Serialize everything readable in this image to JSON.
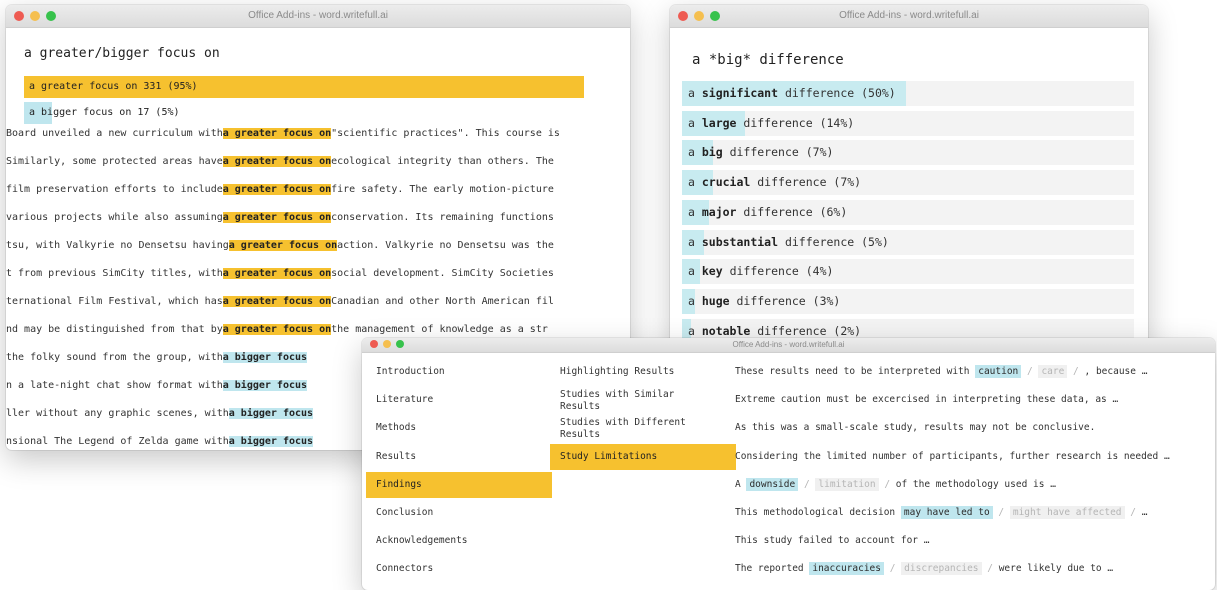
{
  "windows": {
    "w1": {
      "title": "Office Add-ins - word.writefull.ai",
      "query": "a greater/bigger focus on",
      "suggestions": [
        {
          "text": "a greater focus on 331 (95%)",
          "style": "yellow"
        },
        {
          "text": "a bigger focus on 17 (5%)",
          "style": "blue"
        }
      ],
      "examples": [
        {
          "pre": "Board unveiled a new curriculum with",
          "hl": "a greater focus on",
          "post": "\"scientific practices\". This course is",
          "color": "yellow"
        },
        {
          "pre": " Similarly, some protected areas have",
          "hl": "a greater focus on",
          "post": "ecological integrity than others. The",
          "color": "yellow"
        },
        {
          "pre": "  film preservation efforts to include",
          "hl": "a greater focus on",
          "post": "fire safety. The early motion-picture",
          "color": "yellow"
        },
        {
          "pre": " various projects while also assuming",
          "hl": "a greater focus on",
          "post": "conservation. Its remaining functions",
          "color": "yellow"
        },
        {
          "pre": " tsu, with Valkyrie no Densetsu having",
          "hl": "a greater focus on",
          "post": "action. Valkyrie no Densetsu was the",
          "color": "yellow"
        },
        {
          "pre": " t from previous SimCity titles, with",
          "hl": "a greater focus on",
          "post": "social development. SimCity Societies",
          "color": "yellow"
        },
        {
          "pre": "ternational Film Festival, which has",
          "hl": "a greater focus on",
          "post": "Canadian and other North American fil",
          "color": "yellow"
        },
        {
          "pre": "nd may be distinguished from that by",
          "hl": "a greater focus on",
          "post": "the management of knowledge as a str",
          "color": "yellow"
        },
        {
          "pre": "  the folky sound from the group, with",
          "hl": "a bigger focus",
          "post": "",
          "color": "blue"
        },
        {
          "pre": " n a late-night chat show format with",
          "hl": "a bigger focus",
          "post": "",
          "color": "blue"
        },
        {
          "pre": " ller without any graphic scenes, with",
          "hl": "a bigger focus",
          "post": "",
          "color": "blue"
        },
        {
          "pre": " nsional The Legend of Zelda game with",
          "hl": "a bigger focus",
          "post": "",
          "color": "blue"
        }
      ]
    },
    "w2": {
      "title": "Office Add-ins - word.writefull.ai",
      "query": "a *big* difference",
      "rows": [
        {
          "pre": "a ",
          "word": "significant",
          "post": " difference (50%)",
          "pct": 50
        },
        {
          "pre": "a ",
          "word": "large",
          "post": " difference (14%)",
          "pct": 14
        },
        {
          "pre": "a ",
          "word": "big",
          "post": " difference (7%)",
          "pct": 7
        },
        {
          "pre": "a ",
          "word": "crucial",
          "post": " difference (7%)",
          "pct": 7
        },
        {
          "pre": "a ",
          "word": "major",
          "post": " difference (6%)",
          "pct": 6
        },
        {
          "pre": "a ",
          "word": "substantial",
          "post": " difference (5%)",
          "pct": 5
        },
        {
          "pre": "a ",
          "word": "key",
          "post": " difference (4%)",
          "pct": 4
        },
        {
          "pre": "a ",
          "word": "huge",
          "post": " difference (3%)",
          "pct": 3
        },
        {
          "pre": "a ",
          "word": "notable",
          "post": " difference (2%)",
          "pct": 2
        }
      ]
    },
    "w3": {
      "title": "Office Add-ins - word.writefull.ai",
      "sections": [
        "Introduction",
        "Literature",
        "Methods",
        "Results",
        "Findings",
        "Conclusion",
        "Acknowledgements",
        "Connectors"
      ],
      "active_section": "Findings",
      "subsections": [
        "Highlighting Results",
        "Studies with Similar Results",
        "Studies with Different Results",
        "Study Limitations"
      ],
      "active_subsection": "Study Limitations",
      "phrases": [
        {
          "parts": [
            {
              "t": "These results need to be interpreted with ",
              "k": "text"
            },
            {
              "t": "caution",
              "k": "blue"
            },
            {
              "t": " / ",
              "k": "slash"
            },
            {
              "t": "care",
              "k": "grey"
            },
            {
              "t": " / ",
              "k": "slash"
            },
            {
              "t": ", because …",
              "k": "text"
            }
          ]
        },
        {
          "parts": [
            {
              "t": "Extreme caution must be excercised in interpreting these data, as …",
              "k": "text"
            }
          ]
        },
        {
          "parts": [
            {
              "t": "As this was a small-scale study, results may not be conclusive.",
              "k": "text"
            }
          ]
        },
        {
          "parts": [
            {
              "t": "Considering the limited number of participants, further research is needed …",
              "k": "text"
            }
          ]
        },
        {
          "parts": [
            {
              "t": "A ",
              "k": "text"
            },
            {
              "t": "downside",
              "k": "blue"
            },
            {
              "t": " / ",
              "k": "slash"
            },
            {
              "t": "limitation",
              "k": "grey"
            },
            {
              "t": " / ",
              "k": "slash"
            },
            {
              "t": " of the methodology used is …",
              "k": "text"
            }
          ]
        },
        {
          "parts": [
            {
              "t": "This methodological decision ",
              "k": "text"
            },
            {
              "t": "may have led to",
              "k": "blue"
            },
            {
              "t": " / ",
              "k": "slash"
            },
            {
              "t": "might have affected",
              "k": "grey"
            },
            {
              "t": " / ",
              "k": "slash"
            },
            {
              "t": " …",
              "k": "text"
            }
          ]
        },
        {
          "parts": [
            {
              "t": "This study failed to account for …",
              "k": "text"
            }
          ]
        },
        {
          "parts": [
            {
              "t": "The reported ",
              "k": "text"
            },
            {
              "t": "inaccuracies",
              "k": "blue"
            },
            {
              "t": " / ",
              "k": "slash"
            },
            {
              "t": "discrepancies",
              "k": "grey"
            },
            {
              "t": " / ",
              "k": "slash"
            },
            {
              "t": " were likely due to …",
              "k": "text"
            }
          ]
        }
      ]
    }
  },
  "colors": {
    "highlight_yellow": "#f6c12f",
    "highlight_blue": "#bfe6ee",
    "muted": "#b5b5b5"
  }
}
